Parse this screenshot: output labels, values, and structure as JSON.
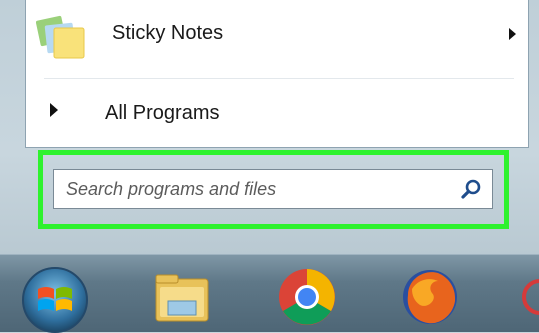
{
  "start_menu": {
    "items": [
      {
        "label": "Sticky Notes",
        "has_submenu": true
      }
    ],
    "all_programs_label": "All Programs",
    "search": {
      "value": "",
      "placeholder": "Search programs and files"
    }
  },
  "colors": {
    "highlight": "#2ef22e",
    "taskbar": "#5f7888"
  },
  "taskbar": {
    "icons": [
      "windows-start-orb",
      "file-explorer-icon",
      "chrome-icon",
      "firefox-icon",
      "partial-app-icon"
    ]
  }
}
